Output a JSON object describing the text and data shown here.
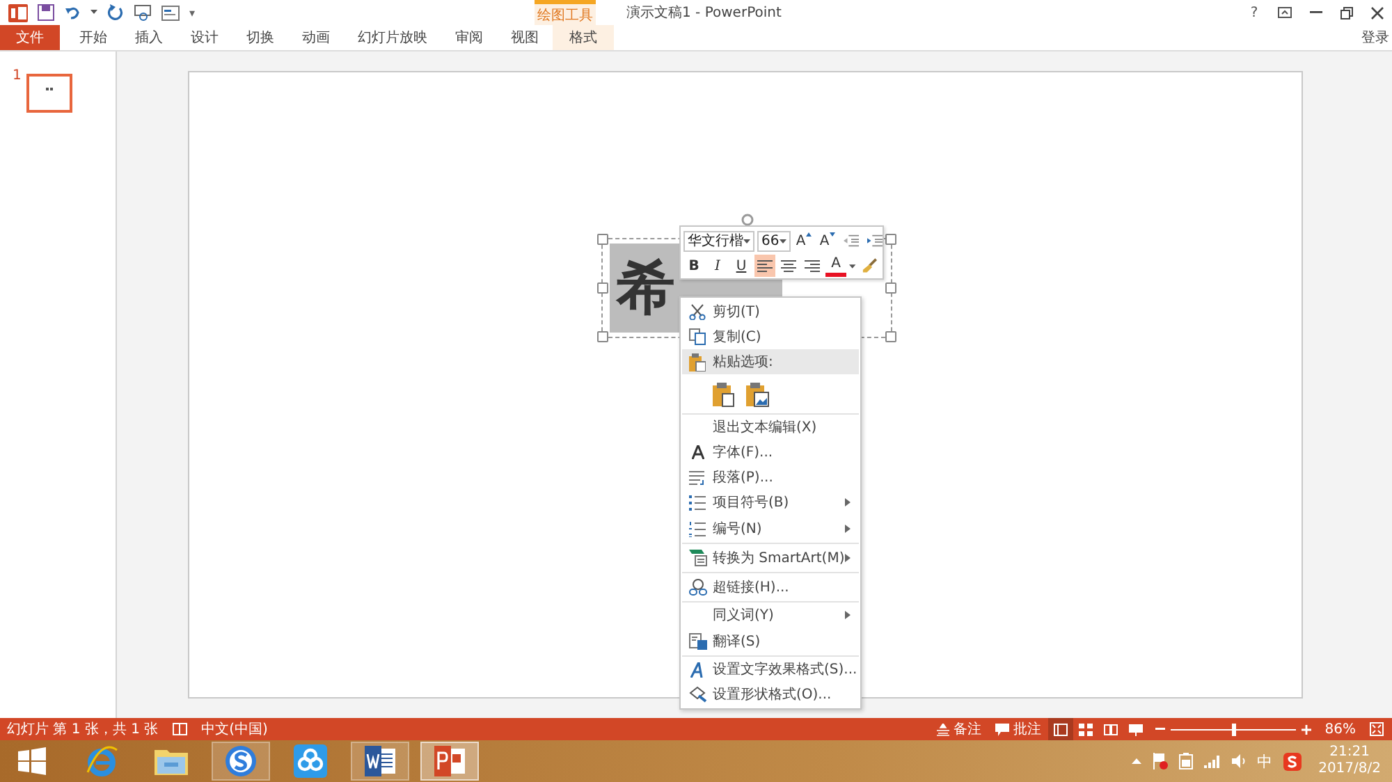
{
  "title_bar": {
    "title": "演示文稿1 - PowerPoint",
    "contextual_group": "绘图工具",
    "help": "?",
    "customize": "▾"
  },
  "tabs": [
    {
      "label": "文件",
      "kind": "file",
      "selected": false
    },
    {
      "label": "开始",
      "kind": "normal",
      "selected": false
    },
    {
      "label": "插入",
      "kind": "normal",
      "selected": false
    },
    {
      "label": "设计",
      "kind": "normal",
      "selected": false
    },
    {
      "label": "切换",
      "kind": "normal",
      "selected": false
    },
    {
      "label": "动画",
      "kind": "normal",
      "selected": false
    },
    {
      "label": "幻灯片放映",
      "kind": "normal",
      "selected": false
    },
    {
      "label": "审阅",
      "kind": "normal",
      "selected": false
    },
    {
      "label": "视图",
      "kind": "normal",
      "selected": false
    },
    {
      "label": "格式",
      "kind": "contextual",
      "selected": false
    }
  ],
  "sign_in": "登录",
  "thumbnails": [
    {
      "number": "1",
      "selected": true
    }
  ],
  "slide": {
    "text_box": {
      "text": "希"
    }
  },
  "mini_toolbar": {
    "font": "华文行楷",
    "size": "66",
    "row1_buttons": [
      {
        "kind": "grow-font",
        "label": "A"
      },
      {
        "kind": "shrink-font",
        "label": "A"
      },
      {
        "kind": "decrease-indent"
      },
      {
        "kind": "increase-indent"
      }
    ],
    "row2_buttons": [
      {
        "kind": "bold",
        "label": "B",
        "selected": false
      },
      {
        "kind": "italic",
        "label": "I",
        "selected": false
      },
      {
        "kind": "underline",
        "label": "U",
        "selected": false
      },
      {
        "kind": "align-left",
        "selected": true
      },
      {
        "kind": "align-center",
        "selected": false
      },
      {
        "kind": "align-right",
        "selected": false
      },
      {
        "kind": "font-color",
        "label": "A",
        "color": "#e81123",
        "selected": false
      },
      {
        "kind": "format-painter",
        "selected": false
      }
    ]
  },
  "context_menu": [
    {
      "kind": "cut",
      "label": "剪切(T)",
      "submenu": false,
      "separator_after": false
    },
    {
      "kind": "copy",
      "label": "复制(C)",
      "submenu": false,
      "separator_after": false
    },
    {
      "kind": "paste-header",
      "label": "粘贴选项:",
      "submenu": false,
      "separator_after": false
    },
    {
      "kind": "paste-options",
      "separator_after": true
    },
    {
      "kind": "plain",
      "label": "退出文本编辑(X)",
      "submenu": false,
      "separator_after": false
    },
    {
      "kind": "font",
      "label": "字体(F)...",
      "submenu": false,
      "separator_after": false
    },
    {
      "kind": "paragraph",
      "label": "段落(P)...",
      "submenu": false,
      "separator_after": false
    },
    {
      "kind": "bullets",
      "label": "项目符号(B)",
      "submenu": true,
      "separator_after": false
    },
    {
      "kind": "numbering",
      "label": "编号(N)",
      "submenu": true,
      "separator_after": true
    },
    {
      "kind": "smartart",
      "label": "转换为 SmartArt(M)",
      "submenu": true,
      "separator_after": true
    },
    {
      "kind": "link",
      "label": "超链接(H)...",
      "submenu": false,
      "separator_after": true
    },
    {
      "kind": "plain",
      "label": "同义词(Y)",
      "submenu": true,
      "separator_after": false
    },
    {
      "kind": "translate",
      "label": "翻译(S)",
      "submenu": false,
      "separator_after": true
    },
    {
      "kind": "text-effects",
      "label": "设置文字效果格式(S)...",
      "submenu": false,
      "separator_after": false
    },
    {
      "kind": "shape-format",
      "label": "设置形状格式(O)...",
      "submenu": false,
      "separator_after": false
    }
  ],
  "status_bar": {
    "slide_info": "幻灯片 第 1 张，共 1 张",
    "language": "中文(中国)",
    "notes": "备注",
    "comments": "批注",
    "views": [
      {
        "kind": "normal",
        "selected": true
      },
      {
        "kind": "sorter",
        "selected": false
      },
      {
        "kind": "reading",
        "selected": false
      },
      {
        "kind": "slideshow",
        "selected": false
      }
    ],
    "zoom_slider": {
      "level": 0.5
    },
    "zoom": "86%"
  },
  "taskbar": {
    "apps": [
      {
        "kind": "ie",
        "running": false,
        "selected": false
      },
      {
        "kind": "explorer",
        "running": false,
        "selected": false
      },
      {
        "kind": "sogou",
        "running": true,
        "selected": false
      },
      {
        "kind": "cloud",
        "running": false,
        "selected": false
      },
      {
        "kind": "word",
        "running": true,
        "selected": false
      },
      {
        "kind": "powerpoint",
        "running": true,
        "selected": true
      }
    ],
    "ime": "中",
    "time": "21:21",
    "date": "2017/8/2"
  }
}
